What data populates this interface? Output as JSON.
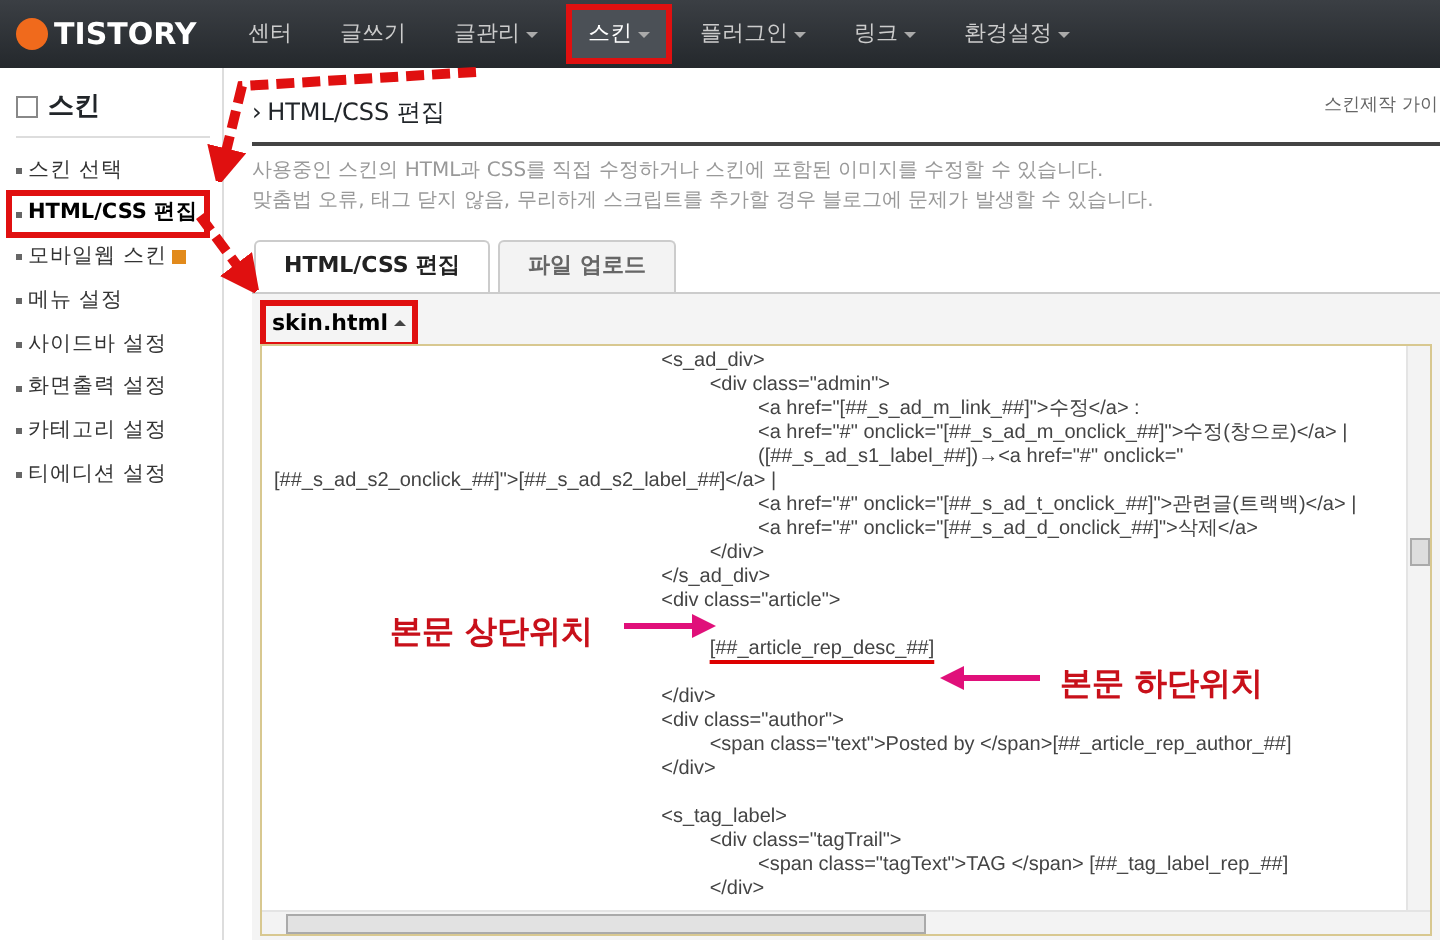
{
  "navbar": {
    "logo": "TISTORY",
    "items": [
      {
        "label": "센터",
        "has_menu": false,
        "selected": false,
        "highlighted": false
      },
      {
        "label": "글쓰기",
        "has_menu": false,
        "selected": false,
        "highlighted": false
      },
      {
        "label": "글관리",
        "has_menu": true,
        "selected": false,
        "highlighted": false
      },
      {
        "label": "스킨",
        "has_menu": true,
        "selected": true,
        "highlighted": true
      },
      {
        "label": "플러그인",
        "has_menu": true,
        "selected": false,
        "highlighted": false
      },
      {
        "label": "링크",
        "has_menu": true,
        "selected": false,
        "highlighted": false
      },
      {
        "label": "환경설정",
        "has_menu": true,
        "selected": false,
        "highlighted": false
      }
    ]
  },
  "sidebar": {
    "title": "스킨",
    "items": [
      {
        "label": "스킨 선택",
        "selected": false,
        "highlighted": false,
        "new": false
      },
      {
        "label": "HTML/CSS 편집",
        "selected": true,
        "highlighted": true,
        "new": false
      },
      {
        "label": "모바일웹 스킨",
        "selected": false,
        "highlighted": false,
        "new": true
      },
      {
        "label": "메뉴 설정",
        "selected": false,
        "highlighted": false,
        "new": false
      },
      {
        "label": "사이드바 설정",
        "selected": false,
        "highlighted": false,
        "new": false
      },
      {
        "label": "화면출력 설정",
        "selected": false,
        "highlighted": false,
        "new": false
      },
      {
        "label": "카테고리 설정",
        "selected": false,
        "highlighted": false,
        "new": false
      },
      {
        "label": "티에디션 설정",
        "selected": false,
        "highlighted": false,
        "new": false
      }
    ]
  },
  "page": {
    "title_marker": "›",
    "title": "HTML/CSS 편집",
    "guide_link": "스킨제작 가이",
    "description": [
      "사용중인 스킨의 HTML과 CSS를 직접 수정하거나 스킨에 포함된 이미지를 수정할 수 있습니다.",
      "맞춤법 오류, 태그 닫지 않음, 무리하게 스크립트를 추가할 경우 블로그에 문제가 발생할 수 있습니다."
    ],
    "tabs": [
      {
        "label": "HTML/CSS 편집",
        "selected": true
      },
      {
        "label": "파일 업로드",
        "selected": false
      }
    ],
    "file_selector": {
      "label": "skin.html",
      "highlighted": true
    },
    "code_lines": [
      {
        "kind": "code",
        "text": "\t\t\t\t\t\t\t\t<s_ad_div>",
        "underlined": false
      },
      {
        "kind": "code",
        "text": "\t\t\t\t\t\t\t\t\t<div class=\"admin\">",
        "underlined": false
      },
      {
        "kind": "code",
        "text": "\t\t\t\t\t\t\t\t\t\t<a href=\"[##_s_ad_m_link_##]\">수정</a> :",
        "underlined": false
      },
      {
        "kind": "code",
        "text": "\t\t\t\t\t\t\t\t\t\t<a href=\"#\" onclick=\"[##_s_ad_m_onclick_##]\">수정(창으로)</a> |",
        "underlined": false
      },
      {
        "kind": "code",
        "text": "\t\t\t\t\t\t\t\t\t\t([##_s_ad_s1_label_##])→<a href=\"#\" onclick=\"",
        "underlined": false
      },
      {
        "kind": "code",
        "text": "[##_s_ad_s2_onclick_##]\">[##_s_ad_s2_label_##]</a> |",
        "underlined": false
      },
      {
        "kind": "code",
        "text": "\t\t\t\t\t\t\t\t\t\t<a href=\"#\" onclick=\"[##_s_ad_t_onclick_##]\">관련글(트랙백)</a> |",
        "underlined": false
      },
      {
        "kind": "code",
        "text": "\t\t\t\t\t\t\t\t\t\t<a href=\"#\" onclick=\"[##_s_ad_d_onclick_##]\">삭제</a>",
        "underlined": false
      },
      {
        "kind": "code",
        "text": "\t\t\t\t\t\t\t\t\t</div>",
        "underlined": false
      },
      {
        "kind": "code",
        "text": "\t\t\t\t\t\t\t\t</s_ad_div>",
        "underlined": false
      },
      {
        "kind": "code",
        "text": "\t\t\t\t\t\t\t\t<div class=\"article\">",
        "underlined": false
      },
      {
        "kind": "blank"
      },
      {
        "kind": "code",
        "text": "\t\t\t\t\t\t\t\t\t[##_article_rep_desc_##]",
        "underlined": true
      },
      {
        "kind": "blank"
      },
      {
        "kind": "code",
        "text": "\t\t\t\t\t\t\t\t</div>",
        "underlined": false
      },
      {
        "kind": "code",
        "text": "\t\t\t\t\t\t\t\t<div class=\"author\">",
        "underlined": false
      },
      {
        "kind": "code",
        "text": "\t\t\t\t\t\t\t\t\t<span class=\"text\">Posted by </span>[##_article_rep_author_##]",
        "underlined": false
      },
      {
        "kind": "code",
        "text": "\t\t\t\t\t\t\t\t</div>",
        "underlined": false
      },
      {
        "kind": "blank"
      },
      {
        "kind": "code",
        "text": "\t\t\t\t\t\t\t\t<s_tag_label>",
        "underlined": false
      },
      {
        "kind": "code",
        "text": "\t\t\t\t\t\t\t\t\t<div class=\"tagTrail\">",
        "underlined": false
      },
      {
        "kind": "code",
        "text": "\t\t\t\t\t\t\t\t\t\t<span class=\"tagText\">TAG </span> [##_tag_label_rep_##]",
        "underlined": false
      },
      {
        "kind": "code",
        "text": "\t\t\t\t\t\t\t\t\t</div>",
        "underlined": false
      }
    ]
  },
  "annotations": [
    {
      "kind": "top",
      "text": "본문 상단위치"
    },
    {
      "kind": "bottom",
      "text": "본문 하단위치"
    }
  ]
}
